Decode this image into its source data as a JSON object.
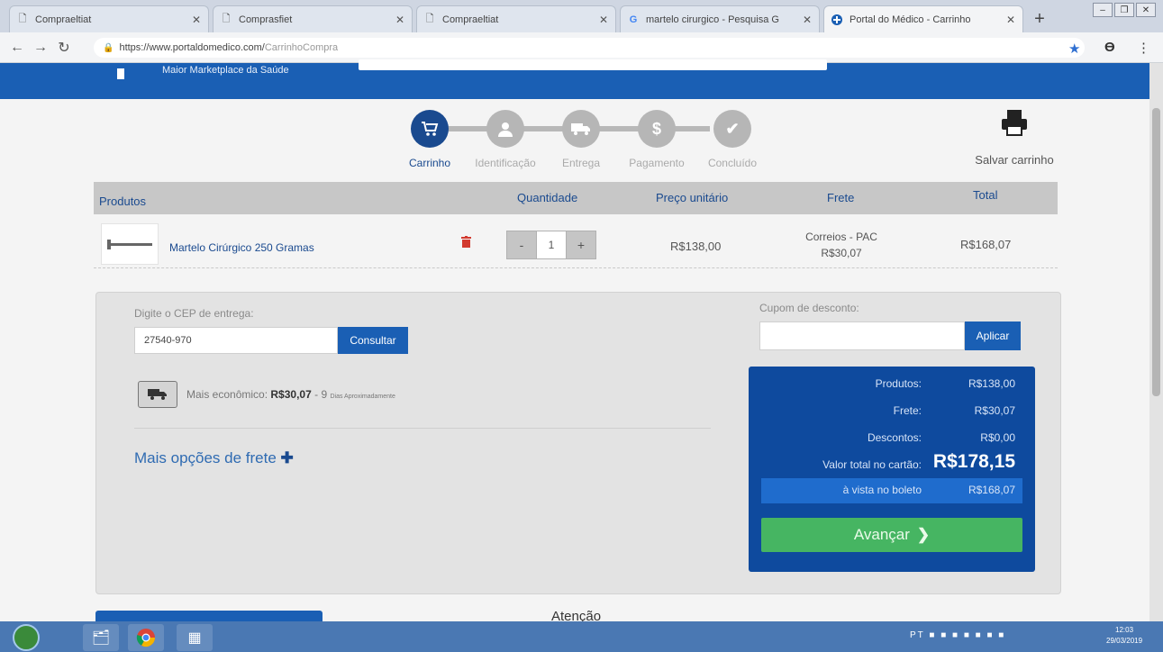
{
  "browser": {
    "tabs": [
      {
        "title": "Compraeltiat",
        "icon": "doc-icon",
        "active": false
      },
      {
        "title": "Comprasfiet",
        "icon": "doc-icon",
        "active": false
      },
      {
        "title": "Compraeltiat",
        "icon": "doc-icon",
        "active": false
      },
      {
        "title": "martelo cirurgico - Pesquisa G",
        "icon": "google-icon",
        "active": false
      },
      {
        "title": "Portal do Médico - Carrinho",
        "icon": "portal-icon",
        "active": true
      }
    ],
    "new_tab": "+",
    "url_host": "https://www.portaldomedico.com/",
    "url_path": "CarrinhoCompra"
  },
  "site": {
    "tagline": "Maior Marketplace da Saúde"
  },
  "steps": [
    {
      "label": "Carrinho",
      "icon": "cart-icon",
      "active": true
    },
    {
      "label": "Identificação",
      "icon": "user-icon",
      "active": false
    },
    {
      "label": "Entrega",
      "icon": "truck-icon",
      "active": false
    },
    {
      "label": "Pagamento",
      "icon": "dollar-icon",
      "active": false
    },
    {
      "label": "Concluído",
      "icon": "check-icon",
      "active": false
    }
  ],
  "save_cart": {
    "label": "Salvar carrinho"
  },
  "table": {
    "headers": {
      "products": "Produtos",
      "quantity": "Quantidade",
      "unit_price": "Preço unitário",
      "freight": "Frete",
      "total": "Total"
    },
    "rows": [
      {
        "name": "Martelo Cirúrgico 250 Gramas",
        "quantity": "1",
        "unit_price": "R$138,00",
        "freight_carrier": "Correios - PAC",
        "freight_price": "R$30,07",
        "total": "R$168,07"
      }
    ]
  },
  "shipping": {
    "cep_label": "Digite o CEP de entrega:",
    "cep_value": "27540-970",
    "consult_button": "Consultar",
    "option_label": "Mais econômico:",
    "option_price": "R$30,07",
    "option_days": "- 9",
    "option_days_note": "Dias Aproximadamente",
    "more_options": "Mais opções de frete"
  },
  "coupon": {
    "label": "Cupom de desconto:",
    "apply_button": "Aplicar"
  },
  "summary": {
    "products_label": "Produtos:",
    "products_value": "R$138,00",
    "freight_label": "Frete:",
    "freight_value": "R$30,07",
    "discounts_label": "Descontos:",
    "discounts_value": "R$0,00",
    "card_total_label": "Valor total no cartão:",
    "card_total_value": "R$178,15",
    "boleto_label": "à vista no boleto",
    "boleto_value": "R$168,07",
    "advance_button": "Avançar"
  },
  "footer": {
    "attention": "Atenção"
  },
  "taskbar": {
    "lang": "PT",
    "time": "12:03",
    "date": "29/03/2019"
  }
}
